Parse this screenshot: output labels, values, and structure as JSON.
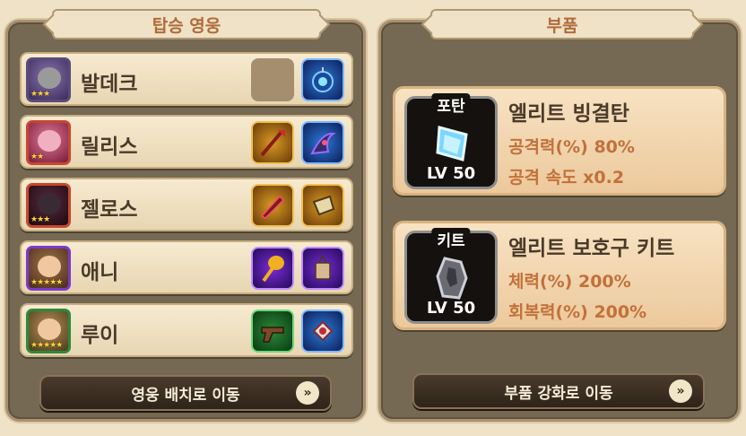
{
  "left_panel": {
    "title": "탑승 영웅",
    "heroes": [
      {
        "name": "발데크",
        "stars": "★★★",
        "portrait": "purple-hat-hero",
        "items": [
          "empty",
          "blue-amulet"
        ]
      },
      {
        "name": "릴리스",
        "stars": "★★",
        "portrait": "pink-hair-hero",
        "items": [
          "gold-spear",
          "blue-claw"
        ]
      },
      {
        "name": "젤로스",
        "stars": "★★★",
        "portrait": "dark-armor-hero",
        "items": [
          "gold-blade",
          "gold-gauntlet"
        ]
      },
      {
        "name": "애니",
        "stars": "★★★★★",
        "portrait": "brown-hair-hero",
        "items": [
          "purple-scepter",
          "purple-bag"
        ]
      },
      {
        "name": "루이",
        "stars": "★★★★★",
        "portrait": "goggles-hero",
        "items": [
          "green-pistol",
          "blue-pendant"
        ]
      }
    ],
    "action_button": "영웅 배치로 이동"
  },
  "right_panel": {
    "title": "부품",
    "parts": [
      {
        "type": "포탄",
        "level": "LV 50",
        "name": "엘리트 빙결탄",
        "stats": [
          "공격력(%) 80%",
          "공격 속도 x0.2"
        ],
        "icon": "ice-crystal-icon"
      },
      {
        "type": "키트",
        "level": "LV 50",
        "name": "엘리트 보호구 키트",
        "stats": [
          "체력(%) 200%",
          "회복력(%) 200%"
        ],
        "icon": "armor-plate-icon"
      }
    ],
    "action_button": "부품 강화로 이동"
  },
  "arrow_glyph": "»",
  "colors": {
    "accent_text": "#c2713a",
    "header_text": "#b06a3a",
    "panel_bg": "#756953",
    "row_bg": "#f6ead0"
  }
}
